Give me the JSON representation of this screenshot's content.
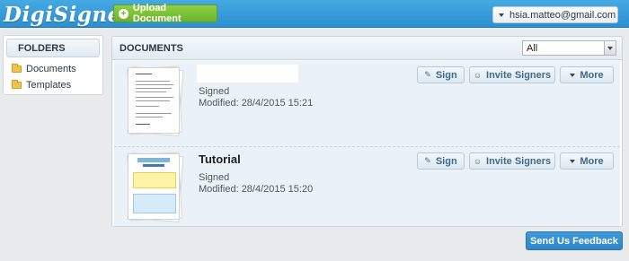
{
  "app": {
    "logo_text": "DigiSigner",
    "accent": "#3c9fdc"
  },
  "header": {
    "upload_label": "Upload Document",
    "user_email": "hsia.matteo@gmail.com"
  },
  "folders": {
    "title": "FOLDERS",
    "items": [
      {
        "label": "Documents",
        "icon": "folder-icon"
      },
      {
        "label": "Templates",
        "icon": "folder-icon"
      }
    ]
  },
  "documents": {
    "title": "DOCUMENTS",
    "filter_value": "All",
    "rows": [
      {
        "name": "",
        "status": "Signed",
        "modified": "Modified: 28/4/2015 15:21"
      },
      {
        "name": "Tutorial",
        "status": "Signed",
        "modified": "Modified: 28/4/2015 15:20"
      }
    ],
    "actions": {
      "sign": "Sign",
      "invite": "Invite Signers",
      "more": "More"
    }
  },
  "footer": {
    "feedback_label": "Send Us Feedback"
  }
}
